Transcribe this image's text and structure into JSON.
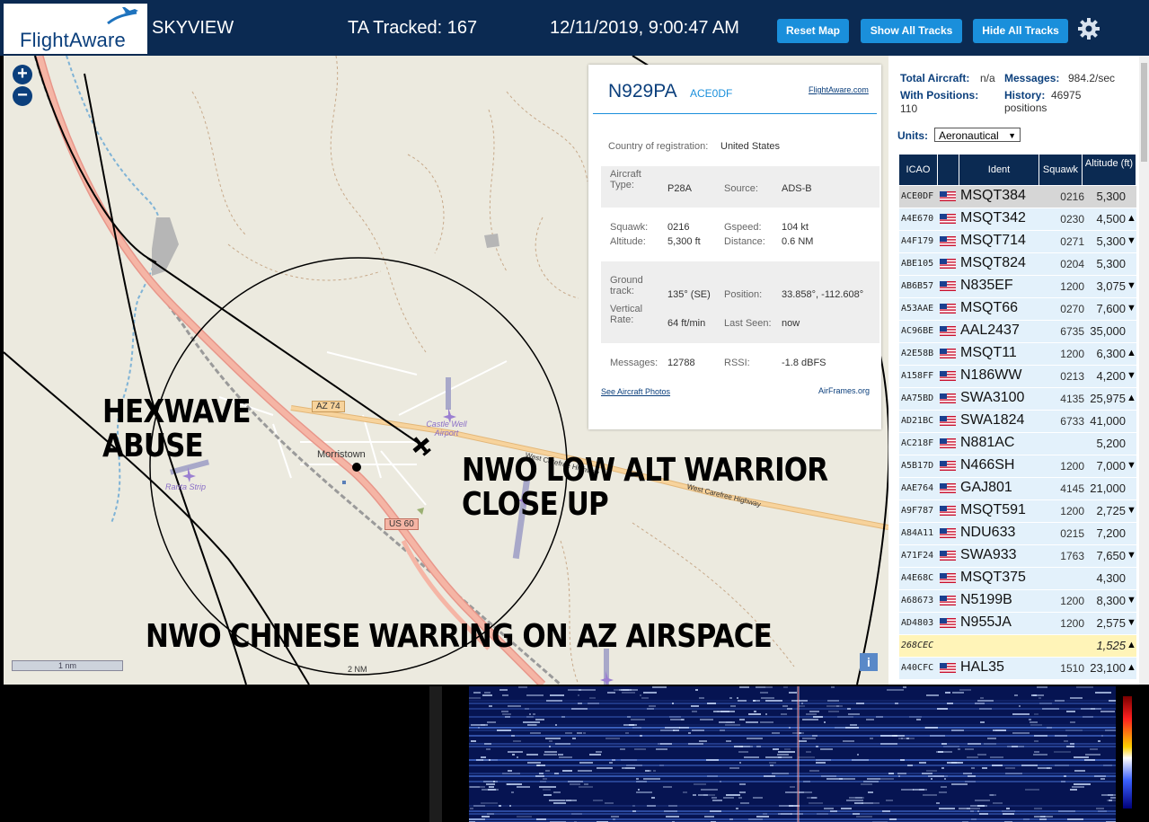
{
  "header": {
    "brand": "FlightAware",
    "app_name": "SKYVIEW",
    "tracked": "TA Tracked: 167",
    "datetime": "12/11/2019, 9:00:47 AM",
    "buttons": [
      "Reset Map",
      "Show All Tracks",
      "Hide All Tracks"
    ]
  },
  "map": {
    "labels": {
      "morristown": "Morristown",
      "az74": "AZ 74",
      "us60": "US 60",
      "castle_well": "Castle Well Airport",
      "ranta": "Ranta Strip",
      "highway1": "West Carefree Highway",
      "highway2": "West Carefree Highway",
      "scale": "1 nm",
      "range": "2 NM",
      "info": "i"
    },
    "overlays": {
      "hexwave": "HEXWAVE ABUSE",
      "warrior": "NWO LOW ALT WARRIOR CLOSE UP",
      "chinese": "NWO CHINESE WARRING ON AZ AIRSPACE"
    }
  },
  "popup": {
    "registration": "N929PA",
    "icao": "ACE0DF",
    "fa_link": "FlightAware.com",
    "country_label": "Country of registration:",
    "country": "United States",
    "aircraft_type_label": "Aircraft Type:",
    "aircraft_type": "P28A",
    "source_label": "Source:",
    "source": "ADS-B",
    "squawk_label": "Squawk:",
    "squawk": "0216",
    "altitude_label": "Altitude:",
    "altitude": "5,300 ft",
    "gspeed_label": "Gspeed:",
    "gspeed": "104 kt",
    "distance_label": "Distance:",
    "distance": "0.6 NM",
    "track_label": "Ground track:",
    "track": "135° (SE)",
    "position_label": "Position:",
    "position": "33.858°, -112.608°",
    "vrate_label": "Vertical Rate:",
    "vrate": "64 ft/min",
    "lastseen_label": "Last Seen:",
    "lastseen": "now",
    "messages_label": "Messages:",
    "messages": "12788",
    "rssi_label": "RSSI:",
    "rssi": "-1.8 dBFS",
    "photos_link": "See Aircraft Photos",
    "airframes_link": "AirFrames.org"
  },
  "sidebar": {
    "total_label": "Total Aircraft:",
    "total": "n/a",
    "messages_label": "Messages:",
    "messages": "984.2/sec",
    "positions_label": "With Positions:",
    "positions": "110",
    "history_label": "History:",
    "history": "46975 positions",
    "units_label": "Units:",
    "units": "Aeronautical",
    "columns": [
      "ICAO",
      "",
      "Ident",
      "Squawk",
      "Altitude (ft)"
    ],
    "rows": [
      {
        "icao": "ACE0DF",
        "flag": true,
        "ident": "MSQT384",
        "squawk": "0216",
        "alt": "5,300",
        "trend": "",
        "style": "sel"
      },
      {
        "icao": "A4E670",
        "flag": true,
        "ident": "MSQT342",
        "squawk": "0230",
        "alt": "4,500",
        "trend": "▲",
        "style": ""
      },
      {
        "icao": "A4F179",
        "flag": true,
        "ident": "MSQT714",
        "squawk": "0271",
        "alt": "5,300",
        "trend": "▼",
        "style": ""
      },
      {
        "icao": "ABE105",
        "flag": true,
        "ident": "MSQT824",
        "squawk": "0204",
        "alt": "5,300",
        "trend": "",
        "style": ""
      },
      {
        "icao": "AB6B57",
        "flag": true,
        "ident": "N835EF",
        "squawk": "1200",
        "alt": "3,075",
        "trend": "▼",
        "style": ""
      },
      {
        "icao": "A53AAE",
        "flag": true,
        "ident": "MSQT66",
        "squawk": "0270",
        "alt": "7,600",
        "trend": "▼",
        "style": ""
      },
      {
        "icao": "AC96BE",
        "flag": true,
        "ident": "AAL2437",
        "squawk": "6735",
        "alt": "35,000",
        "trend": "",
        "style": ""
      },
      {
        "icao": "A2E58B",
        "flag": true,
        "ident": "MSQT11",
        "squawk": "1200",
        "alt": "6,300",
        "trend": "▲",
        "style": ""
      },
      {
        "icao": "A158FF",
        "flag": true,
        "ident": "N186WW",
        "squawk": "0213",
        "alt": "4,200",
        "trend": "▼",
        "style": ""
      },
      {
        "icao": "AA75BD",
        "flag": true,
        "ident": "SWA3100",
        "squawk": "4135",
        "alt": "25,975",
        "trend": "▲",
        "style": ""
      },
      {
        "icao": "AD21BC",
        "flag": true,
        "ident": "SWA1824",
        "squawk": "6733",
        "alt": "41,000",
        "trend": "",
        "style": ""
      },
      {
        "icao": "AC218F",
        "flag": true,
        "ident": "N881AC",
        "squawk": "",
        "alt": "5,200",
        "trend": "",
        "style": ""
      },
      {
        "icao": "A5B17D",
        "flag": true,
        "ident": "N466SH",
        "squawk": "1200",
        "alt": "7,000",
        "trend": "▼",
        "style": ""
      },
      {
        "icao": "AAE764",
        "flag": true,
        "ident": "GAJ801",
        "squawk": "4145",
        "alt": "21,000",
        "trend": "",
        "style": ""
      },
      {
        "icao": "A9F787",
        "flag": true,
        "ident": "MSQT591",
        "squawk": "1200",
        "alt": "2,725",
        "trend": "▼",
        "style": ""
      },
      {
        "icao": "A84A11",
        "flag": true,
        "ident": "NDU633",
        "squawk": "0215",
        "alt": "7,200",
        "trend": "",
        "style": ""
      },
      {
        "icao": "A71F24",
        "flag": true,
        "ident": "SWA933",
        "squawk": "1763",
        "alt": "7,650",
        "trend": "▼",
        "style": ""
      },
      {
        "icao": "A4E68C",
        "flag": true,
        "ident": "MSQT375",
        "squawk": "",
        "alt": "4,300",
        "trend": "",
        "style": ""
      },
      {
        "icao": "A68673",
        "flag": true,
        "ident": "N5199B",
        "squawk": "1200",
        "alt": "8,300",
        "trend": "▼",
        "style": ""
      },
      {
        "icao": "AD4803",
        "flag": true,
        "ident": "N955JA",
        "squawk": "1200",
        "alt": "2,575",
        "trend": "▼",
        "style": ""
      },
      {
        "icao": "268CEC",
        "flag": false,
        "ident": "",
        "squawk": "",
        "alt": "1,525",
        "trend": "▲",
        "style": "warn"
      },
      {
        "icao": "A40CFC",
        "flag": true,
        "ident": "HAL35",
        "squawk": "1510",
        "alt": "23,100",
        "trend": "▲",
        "style": ""
      }
    ]
  },
  "colors": {
    "header_bg": "#0b2a52",
    "button_bg": "#1a8fdb",
    "row_bg": "#e3f1fb",
    "row_selected": "#d6d6d6",
    "row_warning": "#fff4b8",
    "spectrum_bg": "#061452"
  }
}
